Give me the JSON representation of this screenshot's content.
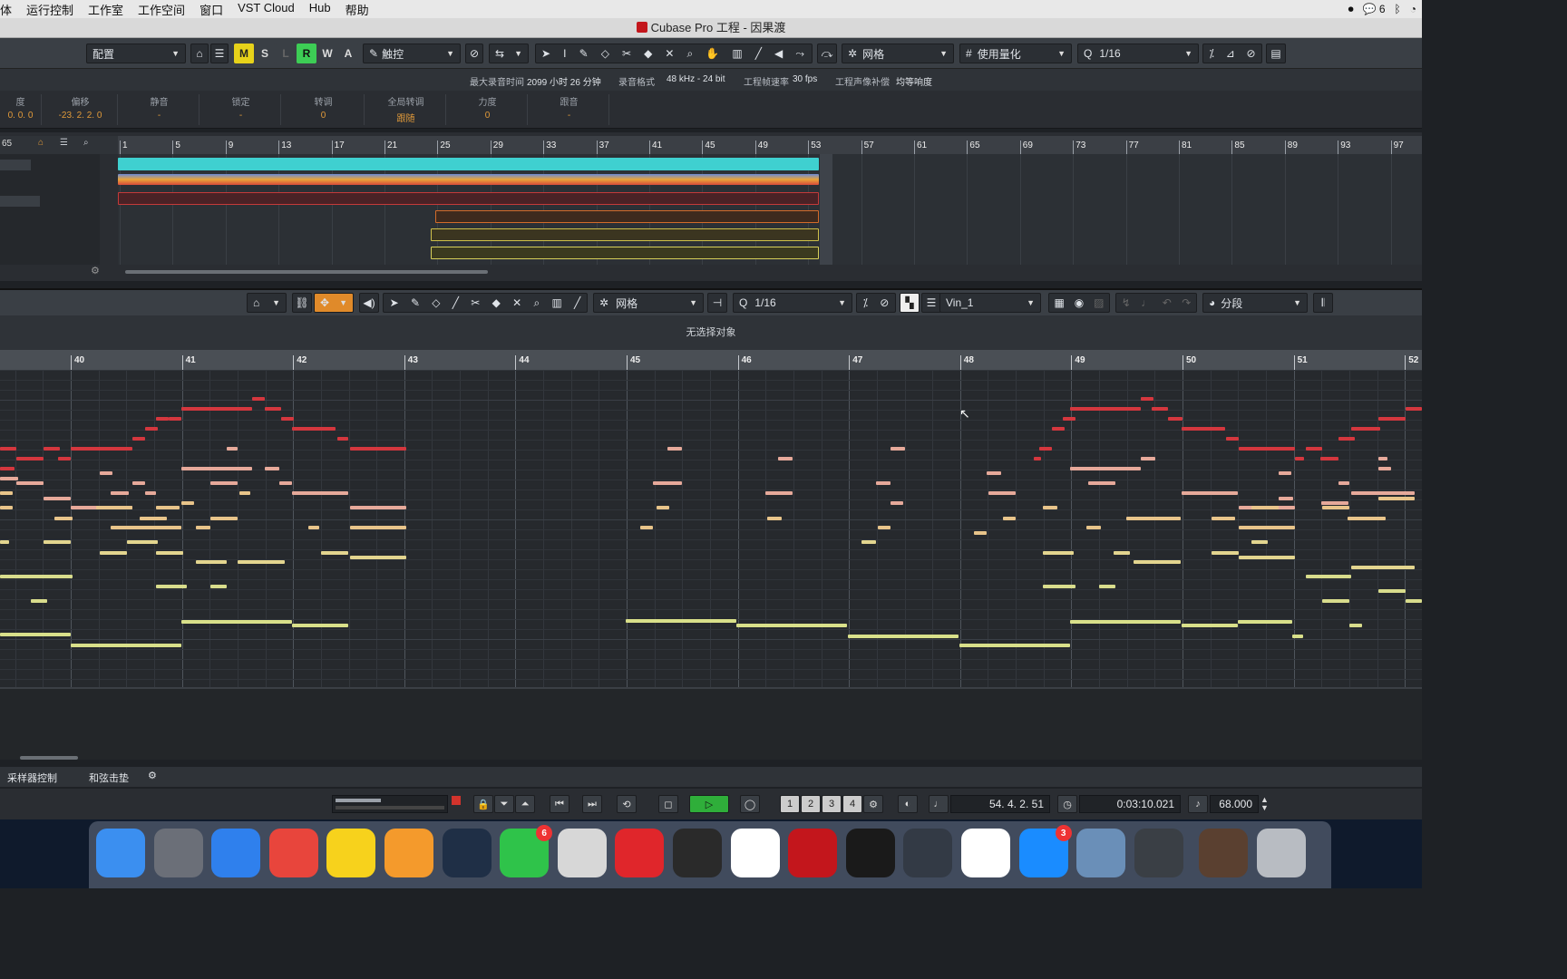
{
  "menubar": {
    "items": [
      "体",
      "运行控制",
      "工作室",
      "工作空间",
      "窗口",
      "VST Cloud",
      "Hub",
      "帮助"
    ],
    "status_icons": [
      "record-icon",
      "wechat-icon",
      "bluetooth-icon",
      "wifi-icon"
    ],
    "wechat_count": "6"
  },
  "window": {
    "title": "Cubase Pro 工程 - 因果渡"
  },
  "toolbar1": {
    "config_label": "配置",
    "mode_buttons": [
      "M",
      "S",
      "L",
      "R",
      "W",
      "A"
    ],
    "automation_mode": "触控",
    "snap_type": "网格",
    "quantize_type": "使用量化",
    "quantize_value": "1/16"
  },
  "infoline": {
    "max_rec_label": "最大录音时间",
    "max_rec_value": "2099 小时 26 分钟",
    "rec_format_label": "录音格式",
    "rec_format_value": "48 kHz - 24 bit",
    "frame_rate_label": "工程帧速率",
    "frame_rate_value": "30 fps",
    "pan_law_label": "工程声像补偿",
    "pan_law_value": "均等响度"
  },
  "inspector": {
    "columns": [
      {
        "label": "度",
        "value": "0. 0. 0"
      },
      {
        "label": "偏移",
        "value": "-23. 2. 2. 0"
      },
      {
        "label": "静音",
        "value": "-"
      },
      {
        "label": "锁定",
        "value": "-"
      },
      {
        "label": "转调",
        "value": "0"
      },
      {
        "label": "全局转调",
        "value": "跟随"
      },
      {
        "label": "力度",
        "value": "0"
      },
      {
        "label": "跟音",
        "value": "-"
      }
    ]
  },
  "project": {
    "track_count": "65",
    "ruler_bars": [
      "1",
      "5",
      "9",
      "13",
      "17",
      "21",
      "25",
      "29",
      "33",
      "37",
      "41",
      "45",
      "49",
      "53",
      "57",
      "61",
      "65",
      "69",
      "73",
      "77",
      "81",
      "85",
      "89",
      "93",
      "97"
    ]
  },
  "key_editor": {
    "snap_type": "网格",
    "quantize_value": "1/16",
    "track_name": "Vin_1",
    "part_mode": "分段",
    "status_text": "无选择对象",
    "ruler_bars": [
      "40",
      "41",
      "42",
      "43",
      "44",
      "45",
      "46",
      "47",
      "48",
      "49",
      "50",
      "51",
      "52"
    ]
  },
  "bottom": {
    "tab_sampler": "采样器控制",
    "tab_chord": "和弦击垫",
    "position": "54. 4. 2. 51",
    "time": "0:03:10.021",
    "tempo": "68.000",
    "markers": [
      "1",
      "2",
      "3",
      "4"
    ]
  },
  "dock": {
    "apps": [
      {
        "name": "finder-icon",
        "color": "#3b8ff0",
        "badge": ""
      },
      {
        "name": "launchpad-icon",
        "color": "#6b6f78",
        "badge": ""
      },
      {
        "name": "safari-icon",
        "color": "#2f80ed",
        "badge": ""
      },
      {
        "name": "chrome-icon",
        "color": "#e8453c",
        "badge": ""
      },
      {
        "name": "qq-music-icon",
        "color": "#f7d21c",
        "badge": ""
      },
      {
        "name": "pages-icon",
        "color": "#f49a2c",
        "badge": ""
      },
      {
        "name": "quicktime-icon",
        "color": "#1f2f46",
        "badge": ""
      },
      {
        "name": "wechat-icon",
        "color": "#2fc34a",
        "badge": "6"
      },
      {
        "name": "mp3-app-icon",
        "color": "#d7d7d7",
        "badge": ""
      },
      {
        "name": "netease-music-icon",
        "color": "#e0262b",
        "badge": ""
      },
      {
        "name": "logic-icon",
        "color": "#2a2a2a",
        "badge": ""
      },
      {
        "name": "baidu-netdisk-icon",
        "color": "#ffffff",
        "badge": ""
      },
      {
        "name": "cubase-icon",
        "color": "#c3161c",
        "badge": ""
      },
      {
        "name": "activity-monitor-icon",
        "color": "#1a1a1a",
        "badge": ""
      },
      {
        "name": "qc-icon",
        "color": "#333a45",
        "badge": ""
      },
      {
        "name": "link-app-icon",
        "color": "#ffffff",
        "badge": ""
      },
      {
        "name": "app-store-icon",
        "color": "#1a8cff",
        "badge": "3"
      },
      {
        "name": "preview-icon",
        "color": "#6a8fb8",
        "badge": ""
      },
      {
        "name": "rme-totalmix-icon",
        "color": "#3a3f45",
        "badge": ""
      },
      {
        "name": "photo-thumbnail-icon",
        "color": "#5a4030",
        "badge": ""
      },
      {
        "name": "trash-icon",
        "color": "#b8bcc2",
        "badge": ""
      }
    ]
  }
}
